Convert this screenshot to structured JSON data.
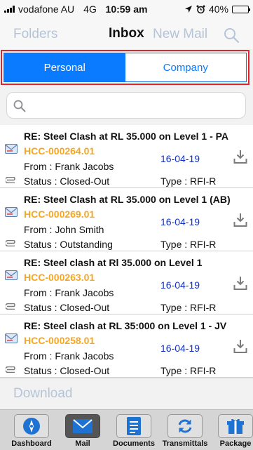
{
  "status_bar": {
    "carrier": "vodafone AU",
    "network": "4G",
    "time": "10:59 am",
    "battery": "40%",
    "battery_level": 0.4
  },
  "nav": {
    "folders_label": "Folders",
    "title": "Inbox",
    "new_mail_label": "New Mail"
  },
  "segments": {
    "personal_label": "Personal",
    "company_label": "Company",
    "selected": "Personal"
  },
  "search": {
    "value": "",
    "placeholder": ""
  },
  "emails": [
    {
      "subject": "RE: Steel Clash at RL 35.000 on Level 1 - PA",
      "code": "HCC-000264.01",
      "date": "16-04-19",
      "from": "From : Frank Jacobs",
      "status": "Status : Closed-Out",
      "type": "Type : RFI-R"
    },
    {
      "subject": "RE: Steel Clash at RL 35.000 on Level 1 (AB)",
      "code": "HCC-000269.01",
      "date": "16-04-19",
      "from": "From : John Smith",
      "status": "Status : Outstanding",
      "type": "Type : RFI-R"
    },
    {
      "subject": "RE: Steel clash at Rl 35.000 on Level 1",
      "code": "HCC-000263.01",
      "date": "16-04-19",
      "from": "From : Frank Jacobs",
      "status": "Status : Closed-Out",
      "type": "Type : RFI-R"
    },
    {
      "subject": "RE: Steel clash at RL 35:000 on Level 1 - JV",
      "code": "HCC-000258.01",
      "date": "16-04-19",
      "from": "From : Frank Jacobs",
      "status": "Status : Closed-Out",
      "type": "Type : RFI-R"
    }
  ],
  "download_label": "Download",
  "tabs": [
    {
      "label": "Dashboard",
      "icon": "compass-icon"
    },
    {
      "label": "Mail",
      "icon": "envelope-icon"
    },
    {
      "label": "Documents",
      "icon": "document-icon"
    },
    {
      "label": "Transmittals",
      "icon": "sync-icon"
    },
    {
      "label": "Package",
      "icon": "gift-icon"
    }
  ],
  "active_tab": "Mail",
  "colors": {
    "accent": "#0a7aff",
    "highlight_border": "#e3222a",
    "code_orange": "#f5a623",
    "date_blue": "#1230c8",
    "muted_nav": "#b5c4d6"
  }
}
